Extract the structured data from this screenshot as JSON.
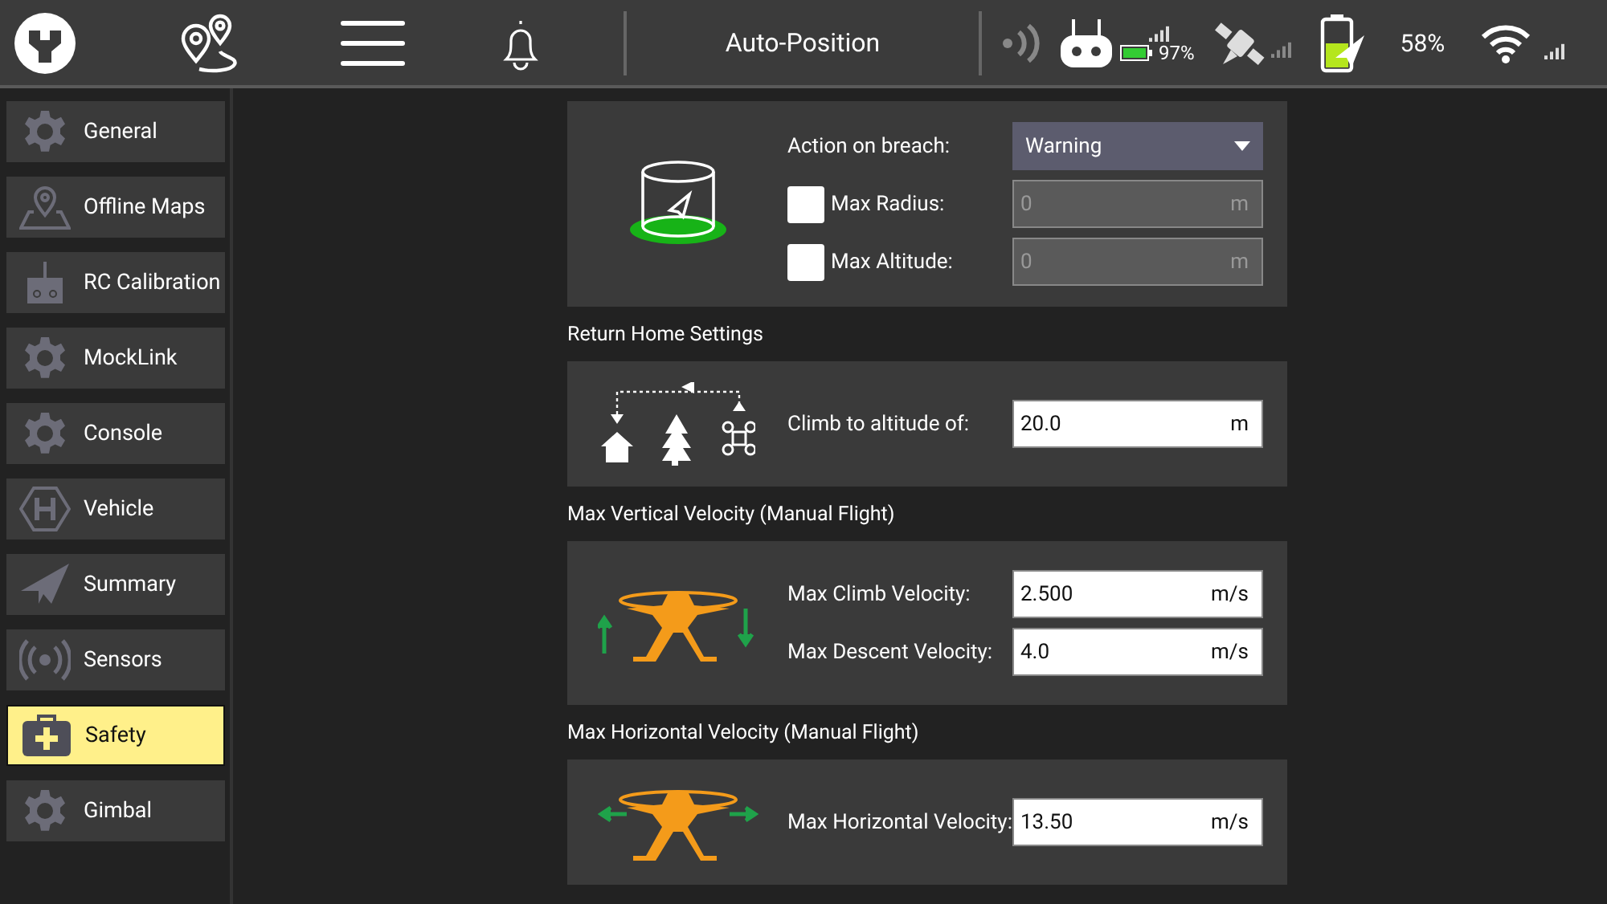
{
  "toolbar": {
    "title": "Auto-Position",
    "rc_battery_reading": "97%",
    "battery_reading": "58%"
  },
  "sidebar": {
    "items": [
      {
        "label": "General",
        "kind": "gear",
        "selected": false
      },
      {
        "label": "Offline Maps",
        "kind": "map",
        "selected": false
      },
      {
        "label": "RC Calibration",
        "kind": "rc",
        "selected": false
      },
      {
        "label": "MockLink",
        "kind": "gear",
        "selected": false
      },
      {
        "label": "Console",
        "kind": "gear",
        "selected": false
      },
      {
        "label": "Vehicle",
        "kind": "vehicle",
        "selected": false
      },
      {
        "label": "Summary",
        "kind": "plane",
        "selected": false
      },
      {
        "label": "Sensors",
        "kind": "sensors",
        "selected": false
      },
      {
        "label": "Safety",
        "kind": "safety",
        "selected": true
      },
      {
        "label": "Gimbal",
        "kind": "gear",
        "selected": false
      }
    ]
  },
  "geofence": {
    "action_label": "Action on breach:",
    "action_value": "Warning",
    "limits": [
      {
        "label": "Max Radius:",
        "checked": false,
        "disabled": true,
        "value": "0",
        "unit": "m"
      },
      {
        "label": "Max Altitude:",
        "checked": false,
        "disabled": true,
        "value": "0",
        "unit": "m"
      }
    ]
  },
  "sections": [
    {
      "heading": "Return Home Settings",
      "kind": "return_home",
      "fields": [
        {
          "label": "Climb to altitude of:",
          "value": "20.0",
          "unit": "m"
        }
      ]
    },
    {
      "heading": "Max Vertical Velocity (Manual Flight)",
      "kind": "vertical",
      "fields": [
        {
          "label": "Max Climb Velocity:",
          "value": "2.500",
          "unit": "m/s"
        },
        {
          "label": "Max Descent Velocity:",
          "value": "4.0",
          "unit": "m/s"
        }
      ]
    },
    {
      "heading": "Max Horizontal Velocity (Manual Flight)",
      "kind": "horizontal",
      "fields": [
        {
          "label": "Max Horizontal Velocity:",
          "value": "13.50",
          "unit": "m/s"
        }
      ]
    }
  ]
}
